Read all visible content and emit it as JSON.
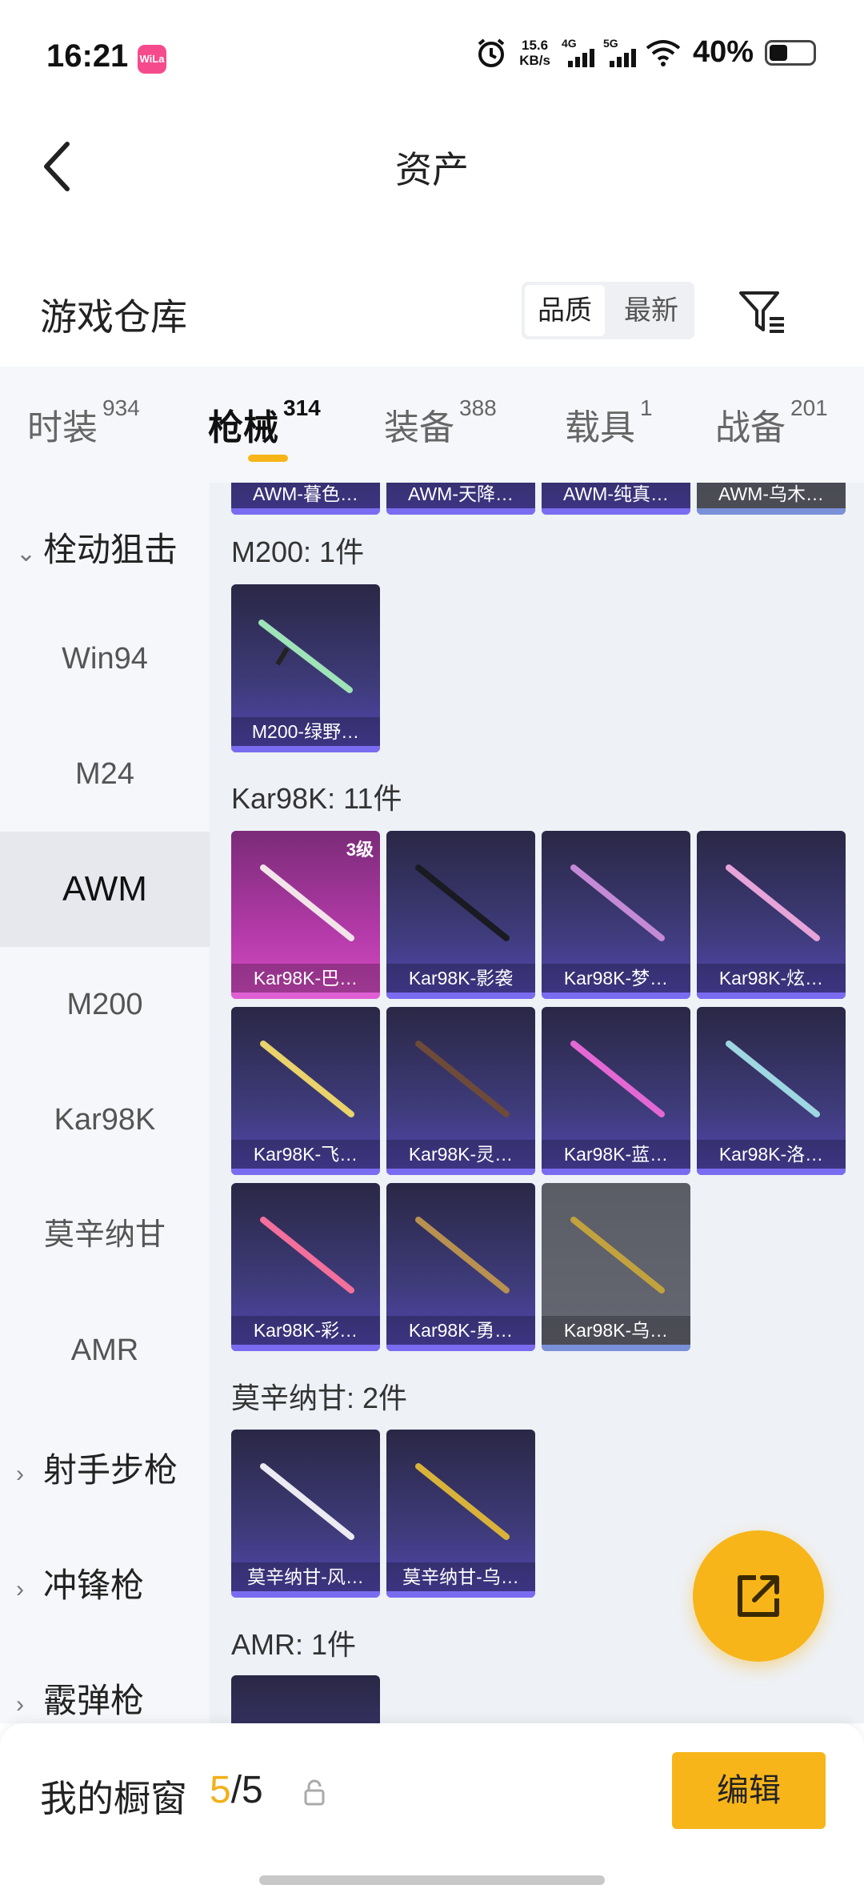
{
  "status_bar": {
    "time": "16:21",
    "app_icon_text": "WiLa",
    "speed_value": "15.6",
    "speed_unit": "KB/s",
    "net1": "4G",
    "net2": "5G",
    "battery": "40%"
  },
  "nav": {
    "title": "资产"
  },
  "section": {
    "title": "游戏仓库",
    "sort_options": [
      "品质",
      "最新"
    ],
    "active_sort": "品质"
  },
  "tabs": [
    {
      "label": "时装",
      "count": "934"
    },
    {
      "label": "枪械",
      "count": "314"
    },
    {
      "label": "装备",
      "count": "388"
    },
    {
      "label": "载具",
      "count": "1"
    },
    {
      "label": "战备",
      "count": "201"
    }
  ],
  "active_tab": "枪械",
  "sidebar": {
    "group_open": "栓动狙击",
    "items": [
      "Win94",
      "M24",
      "AWM",
      "M200",
      "Kar98K",
      "莫辛纳甘",
      "AMR"
    ],
    "active_item": "AWM",
    "groups_closed": [
      "射手步枪",
      "冲锋枪",
      "霰弹枪"
    ]
  },
  "content": {
    "top_row": [
      "AWM-暮色…",
      "AWM-天降…",
      "AWM-纯真…",
      "AWM-乌木…"
    ],
    "groups": [
      {
        "label": "M200: 1件",
        "items": [
          {
            "name": "M200-绿野…",
            "style": "purple"
          }
        ]
      },
      {
        "label": "Kar98K: 11件",
        "items": [
          {
            "name": "Kar98K-巴…",
            "style": "pink",
            "badge": "3级"
          },
          {
            "name": "Kar98K-影袭",
            "style": "purple"
          },
          {
            "name": "Kar98K-梦…",
            "style": "purple"
          },
          {
            "name": "Kar98K-炫…",
            "style": "purple"
          },
          {
            "name": "Kar98K-飞…",
            "style": "purple"
          },
          {
            "name": "Kar98K-灵…",
            "style": "purple"
          },
          {
            "name": "Kar98K-蓝…",
            "style": "purple"
          },
          {
            "name": "Kar98K-洛…",
            "style": "purple"
          },
          {
            "name": "Kar98K-彩…",
            "style": "purple"
          },
          {
            "name": "Kar98K-勇…",
            "style": "purple"
          },
          {
            "name": "Kar98K-乌…",
            "style": "gray"
          }
        ]
      },
      {
        "label": "莫辛纳甘: 2件",
        "items": [
          {
            "name": "莫辛纳甘-风…",
            "style": "purple"
          },
          {
            "name": "莫辛纳甘-乌…",
            "style": "purple"
          }
        ]
      },
      {
        "label": "AMR: 1件",
        "items": []
      }
    ]
  },
  "bottom": {
    "title": "我的橱窗",
    "current": "5",
    "sep": "/",
    "total": "5",
    "edit_label": "编辑"
  },
  "colors": {
    "accent": "#f7b51a",
    "card_purple": "#3e3b7a",
    "card_pink": "#b33aa8",
    "card_gray": "#5b5d66"
  }
}
